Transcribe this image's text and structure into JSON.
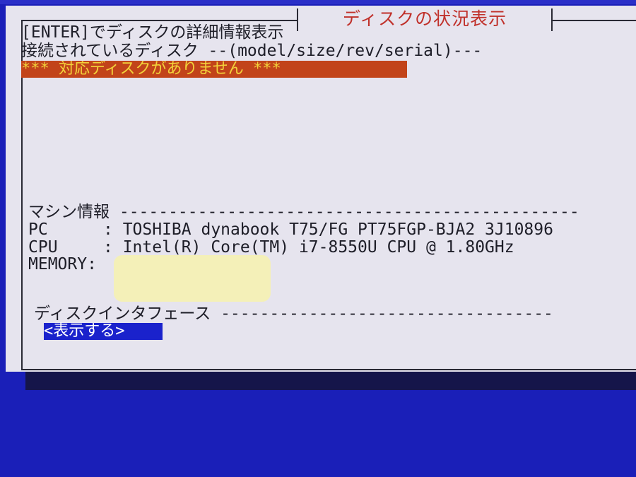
{
  "title": "ディスクの状況表示",
  "hint": "[ENTER]でディスクの詳細情報表示",
  "disk_header": "接続されているディスク --(model/size/rev/serial)---",
  "no_disk_message": "*** 対応ディスクがありません ***",
  "machine_header": "マシン情報 -----------------------------------------------",
  "pc_label": "PC",
  "pc_value": ": TOSHIBA dynabook T75/FG PT75FGP-BJA2 3J10896",
  "cpu_label": "CPU",
  "cpu_value": ": Intel(R) Core(TM) i7-8550U CPU @ 1.80GHz",
  "memory_label": "MEMORY:",
  "interface_header": "ディスクインタフェース ----------------------------------",
  "show_button": "<表示する>",
  "colors": {
    "background": "#1a1fb8",
    "panel": "#e6e4ee",
    "title": "#c0302a",
    "warning_bg": "#c2441a",
    "warning_text": "#f2d23a",
    "button_bg": "#1a22cc"
  }
}
